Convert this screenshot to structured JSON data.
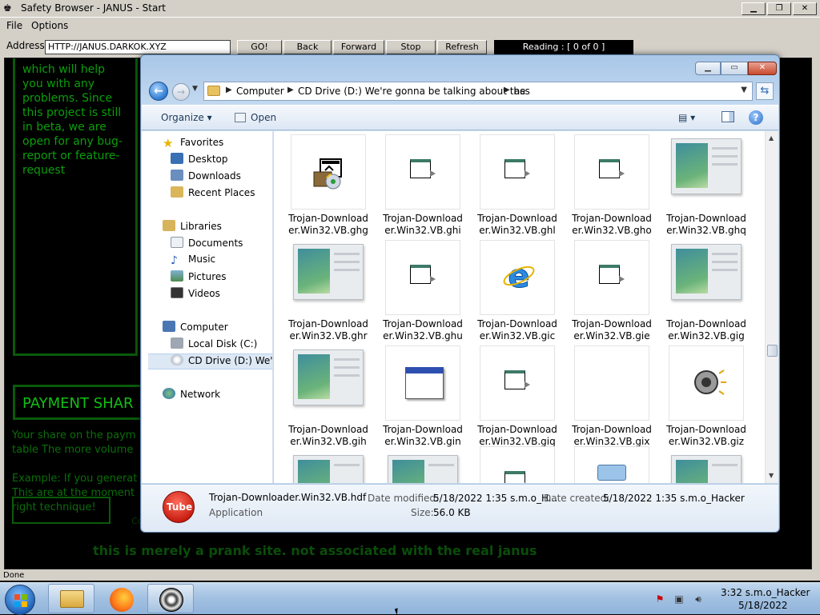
{
  "browser": {
    "title": "Safety Browser - JANUS - Start",
    "menu": [
      "File",
      "Options"
    ],
    "address_label": "Address :",
    "url": "HTTP://JANUS.DARKOK.XYZ",
    "buttons": {
      "go": "GO!",
      "back": "Back",
      "forward": "Forward",
      "stop": "Stop",
      "refresh": "Refresh"
    },
    "reading": "Reading : [ 0  of  0 ]",
    "status": "Done"
  },
  "page": {
    "intro_text": "which will help you with any problems. Since this project is still in beta, we are open for any bug-report or feature-request",
    "payment_title": "PAYMENT SHAR",
    "payment_line1": "Your share on the paym table The more volume",
    "payment_line2": "Example: If you generat This are at the moment right technique!",
    "faint": "Co",
    "disclaimer": "this is merely a prank site. not associated with the real janus"
  },
  "explorer": {
    "breadcrumb": [
      "Computer",
      "CD Drive (D:) We're gonna be talking about the",
      "ass"
    ],
    "toolbar": {
      "organize": "Organize",
      "open": "Open"
    },
    "nav": {
      "favorites": "Favorites",
      "favorites_items": [
        "Desktop",
        "Downloads",
        "Recent Places"
      ],
      "libraries": "Libraries",
      "libraries_items": [
        "Documents",
        "Music",
        "Pictures",
        "Videos"
      ],
      "computer": "Computer",
      "computer_items": [
        "Local Disk (C:)",
        "CD Drive (D:) We're g"
      ],
      "network": "Network"
    },
    "files": [
      {
        "l1": "Trojan-Download",
        "l2": "er.Win32.VB.ghg",
        "icon": "installer-icon"
      },
      {
        "l1": "Trojan-Download",
        "l2": "er.Win32.VB.ghi",
        "icon": "file-icon"
      },
      {
        "l1": "Trojan-Download",
        "l2": "er.Win32.VB.ghl",
        "icon": "file-icon"
      },
      {
        "l1": "Trojan-Download",
        "l2": "er.Win32.VB.gho",
        "icon": "file-icon"
      },
      {
        "l1": "Trojan-Download",
        "l2": "er.Win32.VB.ghq",
        "icon": "image-icon"
      },
      {
        "l1": "Trojan-Download",
        "l2": "er.Win32.VB.ghr",
        "icon": "image-icon"
      },
      {
        "l1": "Trojan-Download",
        "l2": "er.Win32.VB.ghu",
        "icon": "file-icon"
      },
      {
        "l1": "Trojan-Download",
        "l2": "er.Win32.VB.gic",
        "icon": "internet-explorer-icon"
      },
      {
        "l1": "Trojan-Download",
        "l2": "er.Win32.VB.gie",
        "icon": "file-icon"
      },
      {
        "l1": "Trojan-Download",
        "l2": "er.Win32.VB.gig",
        "icon": "image-icon"
      },
      {
        "l1": "Trojan-Download",
        "l2": "er.Win32.VB.gih",
        "icon": "image-icon"
      },
      {
        "l1": "Trojan-Download",
        "l2": "er.Win32.VB.gin",
        "icon": "window-icon"
      },
      {
        "l1": "Trojan-Download",
        "l2": "er.Win32.VB.giq",
        "icon": "file-icon"
      },
      {
        "l1": "Trojan-Download",
        "l2": "er.Win32.VB.gix",
        "icon": "blank-icon"
      },
      {
        "l1": "Trojan-Download",
        "l2": "er.Win32.VB.giz",
        "icon": "speaker-icon"
      }
    ],
    "details": {
      "name": "Trojan-Downloader.Win32.VB.hdf",
      "type": "Application",
      "modified_label": "Date modified:",
      "modified": "5/18/2022 1:35 s.m.o_H...",
      "created_label": "Date created:",
      "created": "5/18/2022 1:35 s.m.o_Hacker",
      "size_label": "Size:",
      "size": "56.0 KB",
      "icon_text": "Tube"
    }
  },
  "taskbar": {
    "time": "3:32 s.m.o_Hacker",
    "date": "5/18/2022"
  }
}
